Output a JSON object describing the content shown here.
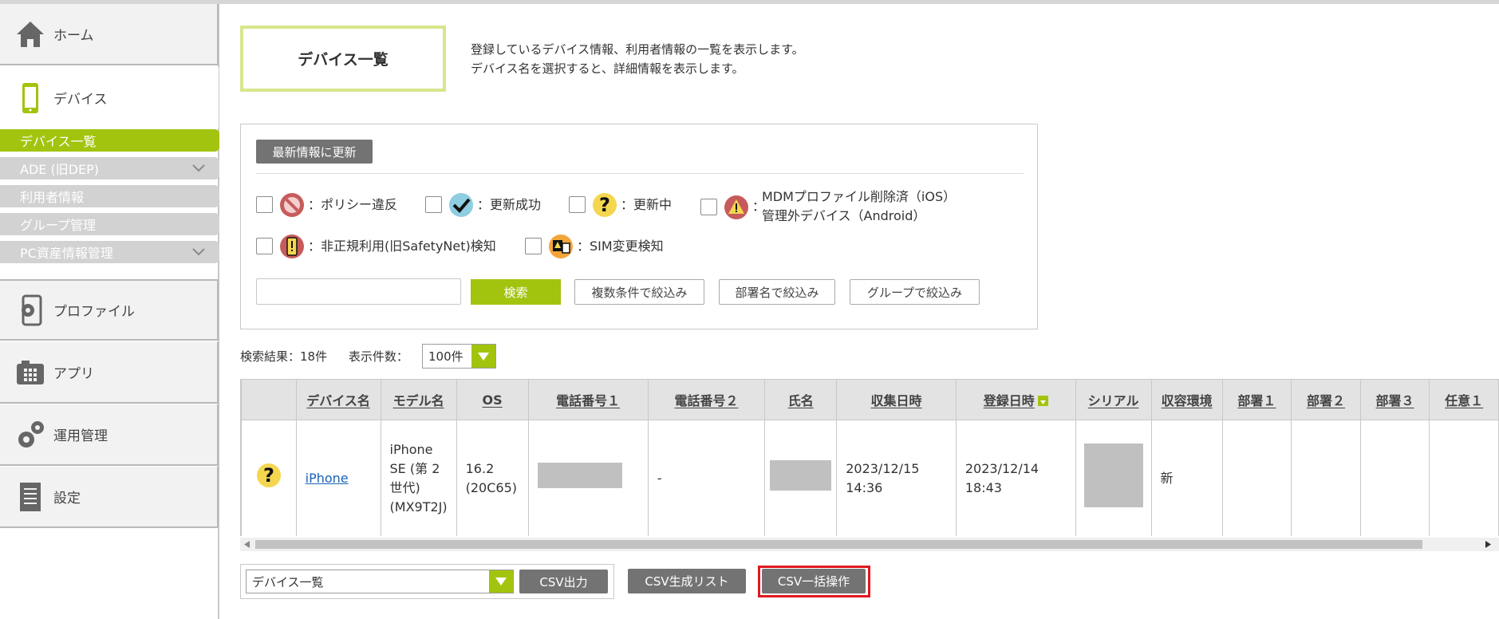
{
  "sidebar": {
    "home": "ホーム",
    "device": "デバイス",
    "device_sub": [
      {
        "label": "デバイス一覧",
        "active": true
      },
      {
        "label": "ADE (旧DEP)",
        "chevron": true
      },
      {
        "label": "利用者情報"
      },
      {
        "label": "グループ管理"
      },
      {
        "label": "PC資産情報管理",
        "chevron": true
      }
    ],
    "profile": "プロファイル",
    "app": "アプリ",
    "ops": "運用管理",
    "settings": "設定"
  },
  "page": {
    "title": "デバイス一覧",
    "desc_line1": "登録しているデバイス情報、利用者情報の一覧を表示します。",
    "desc_line2": "デバイス名を選択すると、詳細情報を表示します。"
  },
  "filter": {
    "refresh_button": "最新情報に更新",
    "legend": {
      "policy_violation": "：ポリシー違反",
      "update_success": "：更新成功",
      "updating": "：更新中",
      "mdm_removed_line1": "MDMプロファイル削除済（iOS）",
      "mdm_removed_line2": "管理外デバイス（Android）",
      "tamper": "：非正規利用(旧SafetyNet)検知",
      "sim_change": "：SIM変更検知"
    },
    "search_value": "",
    "search_button": "検索",
    "multi_filter": "複数条件で絞込み",
    "dept_filter": "部署名で絞込み",
    "group_filter": "グループで絞込み"
  },
  "results": {
    "count_text": "検索結果：18件",
    "per_page_label": "表示件数：",
    "per_page_value": "100件"
  },
  "table": {
    "headers": [
      "",
      "デバイス名",
      "モデル名",
      "OS",
      "電話番号１",
      "電話番号２",
      "氏名",
      "収集日時",
      "登録日時",
      "シリアル",
      "収容環境",
      "部署１",
      "部署２",
      "部署３",
      "任意１"
    ],
    "rows": [
      {
        "status_icon": "question-icon",
        "device_name": "iPhone",
        "model": "iPhone SE (第 2 世代) (MX9T2J)",
        "os": "16.2 (20C65)",
        "phone1": "",
        "phone2": "-",
        "name": "",
        "collected": "2023/12/15 14:36",
        "registered": "2023/12/14 18:43",
        "serial": "",
        "env": "新",
        "dept1": "",
        "dept2": "",
        "dept3": "",
        "opt1": ""
      }
    ]
  },
  "bottom": {
    "csv_select_value": "デバイス一覧",
    "csv_output": "CSV出力",
    "csv_list": "CSV生成リスト",
    "csv_bulk": "CSV一括操作"
  },
  "colors": {
    "accent": "#a2c40e",
    "title_border": "#d8e68c",
    "highlight": "#e0181f",
    "button_gray": "#737373"
  }
}
